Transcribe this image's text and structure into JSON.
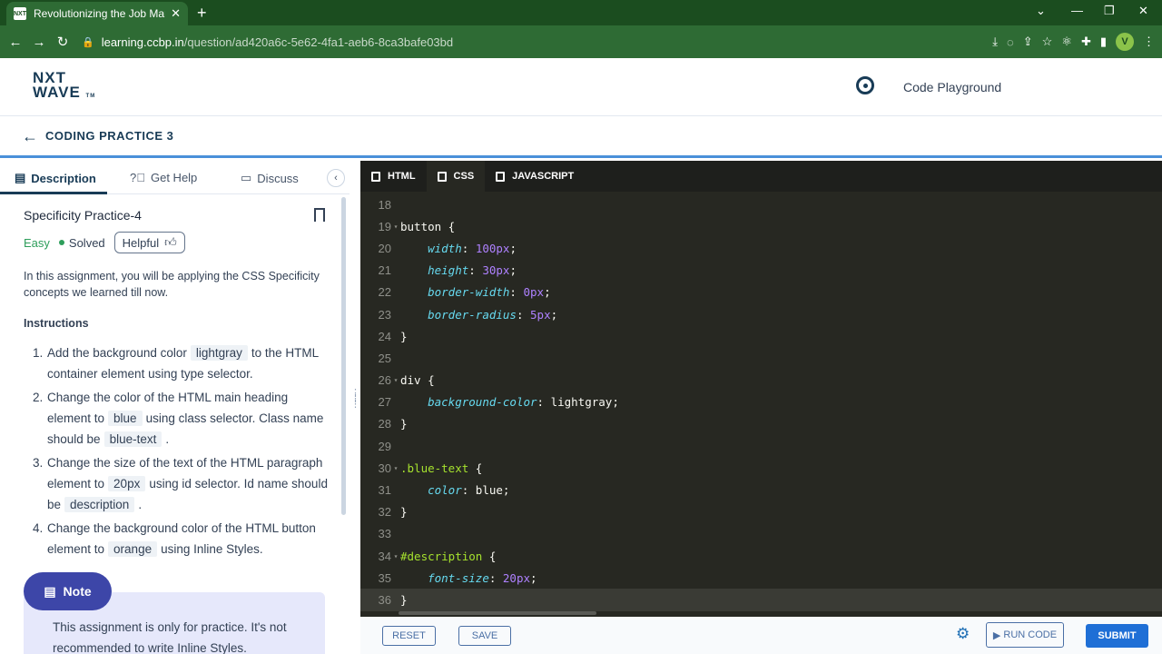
{
  "browser": {
    "tab_title": "Revolutionizing the Job Market |",
    "favicon_text": "NXT",
    "url_host": "learning.ccbp.in",
    "url_path": "/question/ad420a6c-5e62-4fa1-aeb6-8ca3bafe03bd",
    "avatar": "V"
  },
  "header": {
    "logo_line1": "NXT",
    "logo_line2": "WAVE",
    "logo_tm": "TM",
    "code_playground": "Code Playground"
  },
  "subheader": {
    "title": "CODING PRACTICE 3"
  },
  "left": {
    "tabs": [
      "Description",
      "Get Help",
      "Discuss"
    ],
    "question_title": "Specificity Practice-4",
    "difficulty": "Easy",
    "status": "Solved",
    "helpful": "Helpful",
    "intro": "In this assignment, you will be applying the CSS Specificity concepts we learned till now.",
    "instructions_heading": "Instructions",
    "instructions": [
      {
        "num": "1.",
        "a": "Add the background color",
        "chip": "lightgray",
        "b": "to the HTML container element using type selector."
      },
      {
        "num": "2.",
        "a": "Change the color of the HTML main heading element to",
        "chip": "blue",
        "b": "using class selector. Class name should be",
        "chip2": "blue-text",
        "c": "."
      },
      {
        "num": "3.",
        "a": "Change the size of the text of the HTML paragraph element to",
        "chip": "20px",
        "b": "using id selector. Id name should be",
        "chip2": "description",
        "c": "."
      },
      {
        "num": "4.",
        "a": "Change the background color of the HTML button element to",
        "chip": "orange",
        "b": "using Inline Styles."
      }
    ],
    "note_label": "Note",
    "note_text": "This assignment is only for practice. It's not recommended to write Inline Styles."
  },
  "editor": {
    "tabs": [
      "HTML",
      "CSS",
      "JAVASCRIPT"
    ],
    "active_tab": "CSS",
    "lines": [
      {
        "n": "18",
        "t": ""
      },
      {
        "n": "19",
        "t": "button {"
      },
      {
        "n": "20",
        "t": "    width: 100px;"
      },
      {
        "n": "21",
        "t": "    height: 30px;"
      },
      {
        "n": "22",
        "t": "    border-width: 0px;"
      },
      {
        "n": "23",
        "t": "    border-radius: 5px;"
      },
      {
        "n": "24",
        "t": "}"
      },
      {
        "n": "25",
        "t": ""
      },
      {
        "n": "26",
        "t": "div {"
      },
      {
        "n": "27",
        "t": "    background-color: lightgray;"
      },
      {
        "n": "28",
        "t": "}"
      },
      {
        "n": "29",
        "t": ""
      },
      {
        "n": "30",
        "t": ".blue-text {"
      },
      {
        "n": "31",
        "t": "    color: blue;"
      },
      {
        "n": "32",
        "t": "}"
      },
      {
        "n": "33",
        "t": ""
      },
      {
        "n": "34",
        "t": "#description {"
      },
      {
        "n": "35",
        "t": "    font-size: 20px;"
      },
      {
        "n": "36",
        "t": "}"
      }
    ]
  },
  "footer": {
    "reset": "RESET",
    "save": "SAVE",
    "run": "RUN CODE",
    "submit": "SUBMIT"
  },
  "colors": {
    "accent": "#1f6fd6",
    "browser_green": "#2e6b34",
    "editor_bg": "#272822"
  }
}
